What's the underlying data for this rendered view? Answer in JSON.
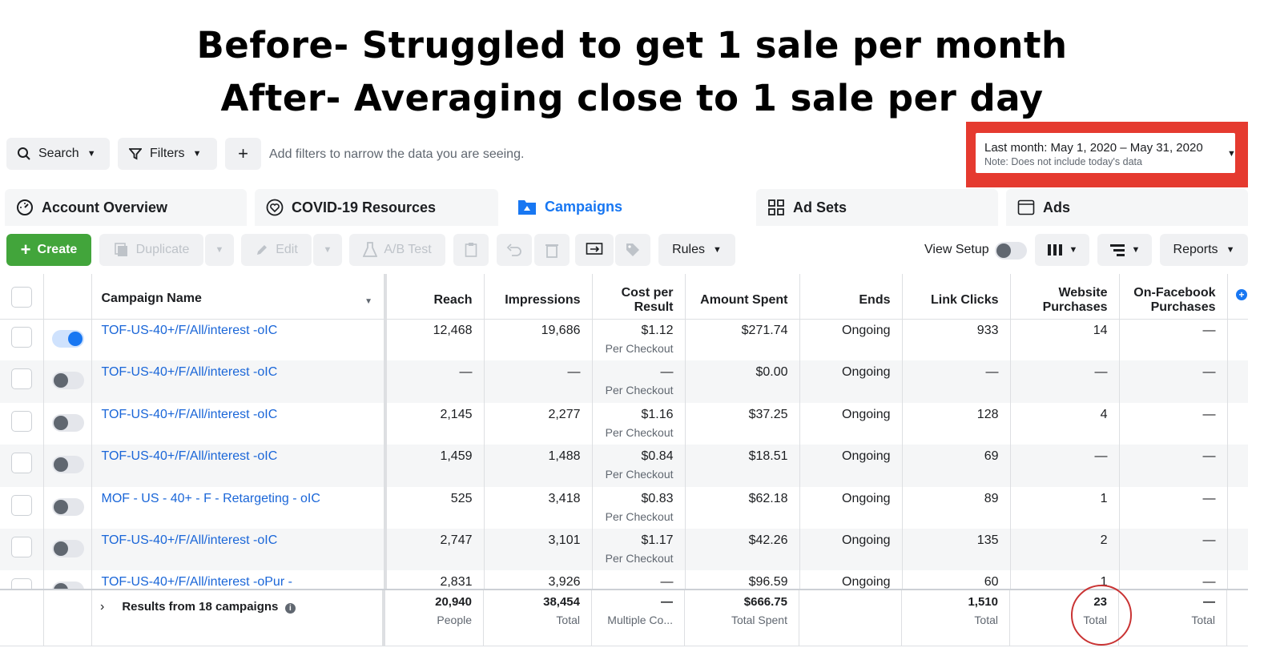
{
  "headline": {
    "line1": "Before- Struggled to get 1 sale per month",
    "line2": "After- Averaging close to 1 sale per day"
  },
  "filterbar": {
    "search_label": "Search",
    "filters_label": "Filters",
    "add_label": "+",
    "hint": "Add filters to narrow the data you are seeing.",
    "date_range": "Last month: May 1, 2020 – May 31, 2020",
    "date_note": "Note: Does not include today's data"
  },
  "tabs": [
    {
      "label": "Account Overview",
      "icon": "gauge-icon",
      "active": false
    },
    {
      "label": "COVID-19 Resources",
      "icon": "heart-icon",
      "active": false
    },
    {
      "label": "Campaigns",
      "icon": "folder-icon",
      "active": true
    },
    {
      "label": "Ad Sets",
      "icon": "grid-icon",
      "active": false
    },
    {
      "label": "Ads",
      "icon": "ad-icon",
      "active": false
    }
  ],
  "toolbar": {
    "create": "Create",
    "duplicate": "Duplicate",
    "edit": "Edit",
    "ab_test": "A/B Test",
    "rules": "Rules",
    "view_setup": "View Setup",
    "reports": "Reports"
  },
  "columns": {
    "name": "Campaign Name",
    "reach": "Reach",
    "impressions": "Impressions",
    "cost1": "Cost per",
    "cost2": "Result",
    "spent": "Amount Spent",
    "ends": "Ends",
    "clicks": "Link Clicks",
    "wp1": "Website",
    "wp2": "Purchases",
    "fb1": "On-Facebook",
    "fb2": "Purchases"
  },
  "rows": [
    {
      "name": "TOF-US-40+/F/All/interest -oIC",
      "on": true,
      "reach": "12,468",
      "impressions": "19,686",
      "cost": "$1.12",
      "cost_sub": "Per Checkout",
      "spent": "$271.74",
      "ends": "Ongoing",
      "clicks": "933",
      "website": "14",
      "onfb": "—"
    },
    {
      "name": "TOF-US-40+/F/All/interest -oIC",
      "on": false,
      "reach": "—",
      "impressions": "—",
      "cost": "—",
      "cost_sub": "Per Checkout",
      "spent": "$0.00",
      "ends": "Ongoing",
      "clicks": "—",
      "website": "—",
      "onfb": "—"
    },
    {
      "name": "TOF-US-40+/F/All/interest -oIC",
      "on": false,
      "reach": "2,145",
      "impressions": "2,277",
      "cost": "$1.16",
      "cost_sub": "Per Checkout",
      "spent": "$37.25",
      "ends": "Ongoing",
      "clicks": "128",
      "website": "4",
      "onfb": "—"
    },
    {
      "name": "TOF-US-40+/F/All/interest -oIC",
      "on": false,
      "reach": "1,459",
      "impressions": "1,488",
      "cost": "$0.84",
      "cost_sub": "Per Checkout",
      "spent": "$18.51",
      "ends": "Ongoing",
      "clicks": "69",
      "website": "—",
      "onfb": "—"
    },
    {
      "name": "MOF - US - 40+ - F - Retargeting - oIC",
      "on": false,
      "reach": "525",
      "impressions": "3,418",
      "cost": "$0.83",
      "cost_sub": "Per Checkout",
      "spent": "$62.18",
      "ends": "Ongoing",
      "clicks": "89",
      "website": "1",
      "onfb": "—"
    },
    {
      "name": "TOF-US-40+/F/All/interest -oIC",
      "on": false,
      "reach": "2,747",
      "impressions": "3,101",
      "cost": "$1.17",
      "cost_sub": "Per Checkout",
      "spent": "$42.26",
      "ends": "Ongoing",
      "clicks": "135",
      "website": "2",
      "onfb": "—"
    },
    {
      "name": "TOF-US-40+/F/All/interest -oPur -",
      "on": false,
      "reach": "2,831",
      "impressions": "3,926",
      "cost": "—",
      "cost_sub": "",
      "spent": "$96.59",
      "ends": "Ongoing",
      "clicks": "60",
      "website": "1",
      "onfb": "—"
    }
  ],
  "footer": {
    "label": "Results from 18 campaigns",
    "reach": "20,940",
    "reach_sub": "People",
    "impressions": "38,454",
    "impressions_sub": "Total",
    "cost": "—",
    "cost_sub": "Multiple Co...",
    "spent": "$666.75",
    "spent_sub": "Total Spent",
    "clicks": "1,510",
    "clicks_sub": "Total",
    "website": "23",
    "website_sub": "Total",
    "onfb": "—",
    "onfb_sub": "Total"
  },
  "colors": {
    "accent": "#1877f2",
    "create": "#42a53b",
    "highlight": "#e53a2f"
  }
}
